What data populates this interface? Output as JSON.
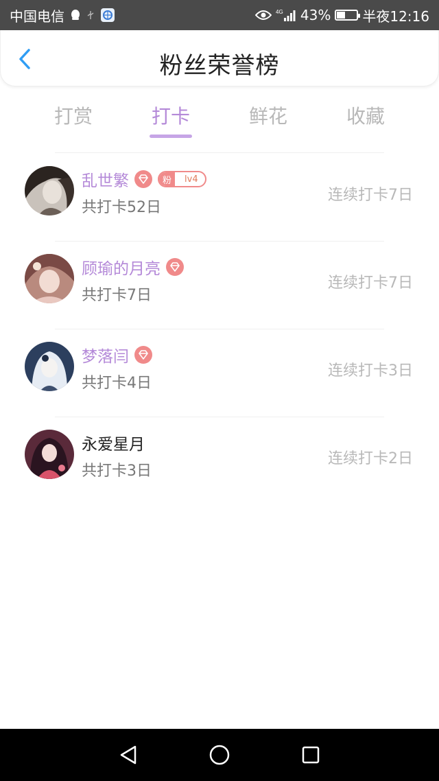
{
  "status_bar": {
    "carrier": "中国电信",
    "network": "4G",
    "battery": "43%",
    "battery_fraction": 0.43,
    "time": "半夜12:16"
  },
  "header": {
    "title": "粉丝荣誉榜",
    "back_icon": "chevron-left-icon"
  },
  "tabs": [
    {
      "label": "打赏",
      "active": false
    },
    {
      "label": "打卡",
      "active": true
    },
    {
      "label": "鲜花",
      "active": false
    },
    {
      "label": "收藏",
      "active": false
    }
  ],
  "colors": {
    "accent": "#b489d8",
    "badge": "#f08a8a",
    "muted": "#b8b8b8"
  },
  "list": [
    {
      "name": "乱世繁",
      "has_gem": true,
      "fan_badge": {
        "label": "粉",
        "level": "lv4"
      },
      "total": "共打卡52日",
      "streak": "连续打卡7日",
      "highlight": true
    },
    {
      "name": "顾瑜的月亮",
      "has_gem": true,
      "total": "共打卡7日",
      "streak": "连续打卡7日",
      "highlight": true
    },
    {
      "name": "梦落闫",
      "has_gem": true,
      "total": "共打卡4日",
      "streak": "连续打卡3日",
      "highlight": true
    },
    {
      "name": "永爱星月",
      "has_gem": false,
      "total": "共打卡3日",
      "streak": "连续打卡2日",
      "highlight": false
    }
  ],
  "nav": {
    "back": "triangle-back-icon",
    "home": "circle-home-icon",
    "recent": "square-recent-icon"
  }
}
